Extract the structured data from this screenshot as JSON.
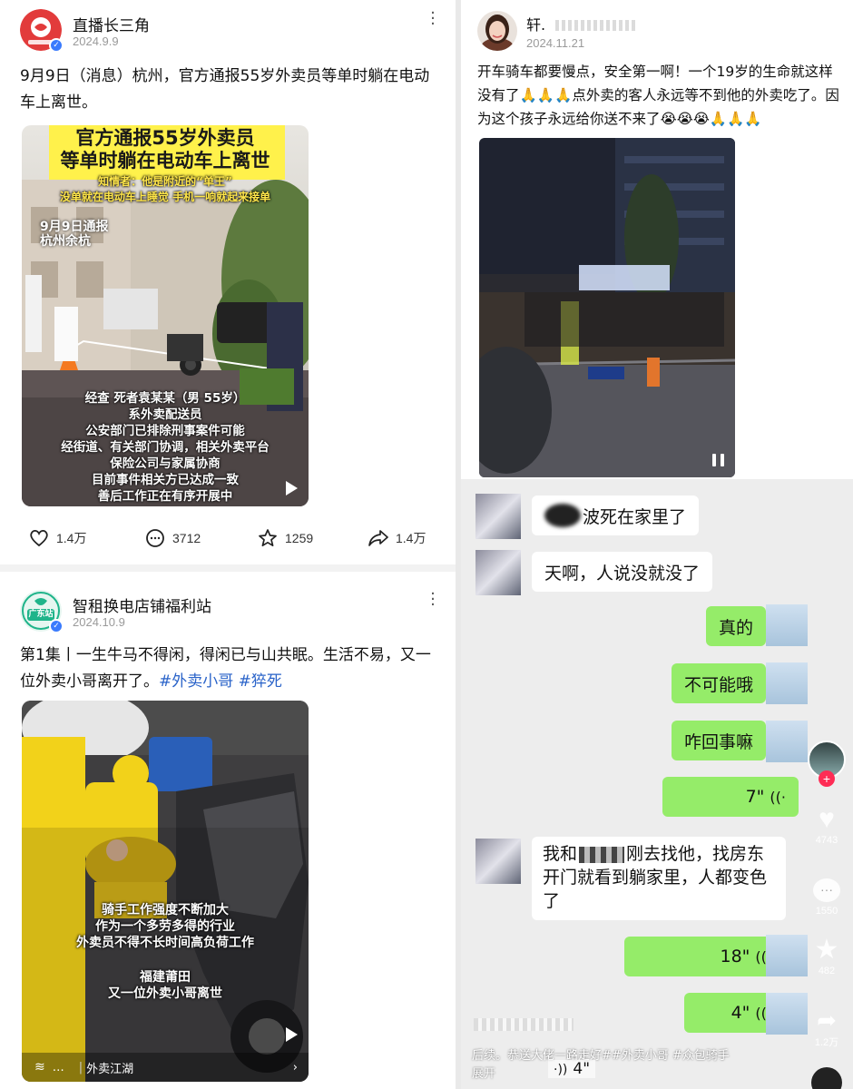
{
  "post1": {
    "author": "直播长三角",
    "date": "2024.9.9",
    "body": "9月9日（消息）杭州，官方通报55岁外卖员等单时躺在电动车上离世。",
    "media": {
      "banner_line1": "官方通报55岁外卖员",
      "banner_line2": "等单时躺在电动车上离世",
      "sub_line1": "知情者：他是附近的“单王”",
      "sub_line2": "没单就在电动车上睡觉 手机一响就起来接单",
      "loc_line1": "9月9日通报",
      "loc_line2": "杭州余杭",
      "caption": [
        "经查 死者袁某某（男 55岁）",
        "系外卖配送员",
        "公安部门已排除刑事案件可能",
        "经街道、有关部门协调，相关外卖平台",
        "保险公司与家属协商",
        "目前事件相关方已达成一致",
        "善后工作正在有序开展中"
      ]
    },
    "likes": "1.4万",
    "comments": "3712",
    "favorites": "1259",
    "shares": "1.4万"
  },
  "post2": {
    "author": "轩.",
    "date": "2024.11.21",
    "body": "开车骑车都要慢点，安全第一啊！一个19岁的生命就这样没有了🙏🙏🙏点外卖的客人永远等不到他的外卖吃了。因为这个孩子永远给你送不来了😭😭😭🙏🙏🙏"
  },
  "post3": {
    "author": "智租换电店铺福利站",
    "avatar_text": "广东站",
    "date": "2024.10.9",
    "body_plain": "第1集丨一生牛马不得闲，得闲已与山共眠。生活不易，又一位外卖小哥离开了。",
    "tags": "#外卖小哥 #猝死",
    "media": {
      "caption": [
        "骑手工作强度不断加大",
        "作为一个多劳多得的行业",
        "外卖员不得不长时间高负荷工作"
      ],
      "place": [
        "福建莆田",
        "又一位外卖小哥离世"
      ],
      "collection": "外卖江湖"
    }
  },
  "chat": {
    "messages": [
      {
        "side": "in",
        "text": "波死在家里了"
      },
      {
        "side": "in",
        "text": "天啊，人说没就没了"
      },
      {
        "side": "out",
        "text": "真的"
      },
      {
        "side": "out",
        "text": "不可能哦"
      },
      {
        "side": "out",
        "text": "咋回事嘛"
      },
      {
        "side": "out",
        "text": "7\""
      },
      {
        "side": "in",
        "text_l1": "我和",
        "text_l1b": "刚去找他，找房东",
        "text_l2": "开门就看到躺家里，人都变色",
        "text_l3": "了"
      },
      {
        "side": "out",
        "text": "18\""
      },
      {
        "side": "out",
        "text": "4\""
      }
    ],
    "rail": {
      "likes": "4743",
      "comments": "1550",
      "favorites": "482",
      "shares": "1.2万"
    },
    "caption": "后续。恭送大佬一路走好##外卖小哥 #众包骑手",
    "expand": "展开",
    "last_voice": "4\""
  }
}
